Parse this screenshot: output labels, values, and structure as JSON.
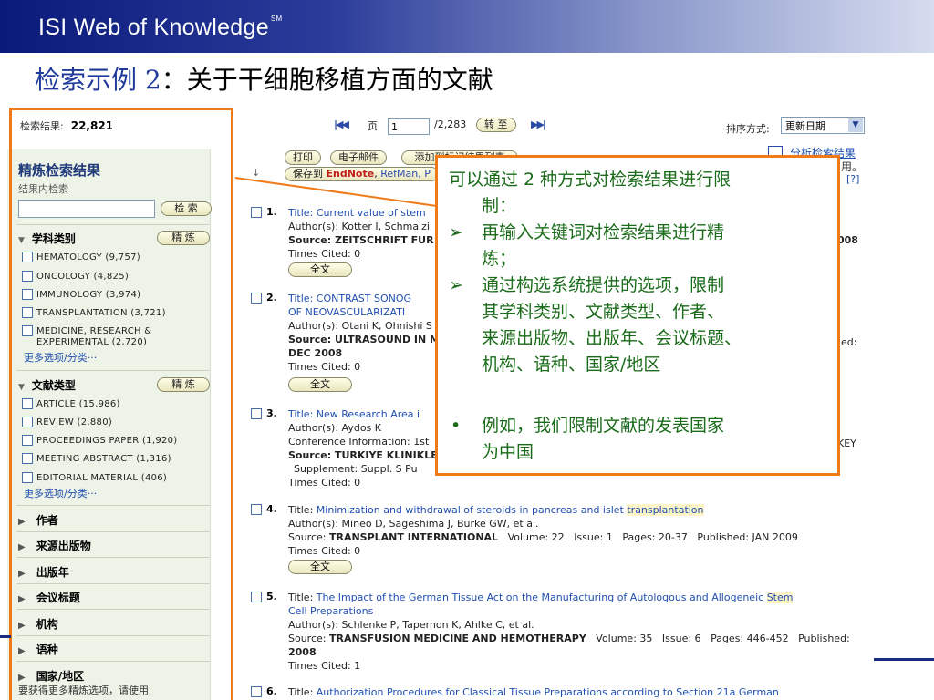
{
  "banner": {
    "title": "ISI Web of Knowledge",
    "trademark": "SM"
  },
  "slide_title": {
    "prefix": "检索示例 2",
    "rest": "：关于干细胞移植方面的文献"
  },
  "results": {
    "label": "检索结果:",
    "count": "22,821"
  },
  "pager": {
    "page_label": "页",
    "page_value": "1",
    "total": "/2,283",
    "go_label": "转 至"
  },
  "sort": {
    "label": "排序方式:",
    "value": "更新日期"
  },
  "toolbar": {
    "print": "打印",
    "email": "电子邮件",
    "add_marked": "添加到标记结果列表",
    "save_to": "保存到",
    "endnote": "EndNote",
    "refman": "RefMan, P"
  },
  "analyze": {
    "label": "分析检索结果",
    "suffix": "用。",
    "help": "[?]"
  },
  "sidebar": {
    "title": "精炼检索结果",
    "within": "结果内检索",
    "search_button": "检 索",
    "refine_button": "精 炼",
    "subject": {
      "heading": "学科类别",
      "items": [
        "HEMATOLOGY (9,757)",
        "ONCOLOGY (4,825)",
        "IMMUNOLOGY (3,974)",
        "TRANSPLANTATION (3,721)",
        "MEDICINE, RESEARCH &",
        "EXPERIMENTAL (2,720)"
      ],
      "more": "更多选项/分类···"
    },
    "doctype": {
      "heading": "文献类型",
      "items": [
        "ARTICLE (15,986)",
        "REVIEW (2,880)",
        "PROCEEDINGS PAPER (1,920)",
        "MEETING ABSTRACT (1,316)",
        "EDITORIAL MATERIAL (406)"
      ],
      "more": "更多选项/分类···"
    },
    "collapsed": [
      "作者",
      "来源出版物",
      "出版年",
      "会议标题",
      "机构",
      "语种",
      "国家/地区"
    ],
    "footnote": "要获得更多精炼选项，请使用"
  },
  "callout": {
    "line1": "可以通过 2 种方式对检索结果进行限",
    "line2": "制：",
    "b1a": "再输入关键词对检索结果进行精",
    "b1b": "炼；",
    "b2a": "通过构选系统提供的选项，限制",
    "b2b": "其学科类别、文献类型、作者、",
    "b2c": "来源出版物、出版年、会议标题、",
    "b2d": "机构、语种、国家/地区",
    "b3a": "例如，我们限制文献的发表国家",
    "b3b": "为中国",
    "arrow": "➢",
    "dot": "•"
  },
  "records": [
    {
      "num": "1.",
      "title": "Title: Current value of stem",
      "authors": "Author(s): Kotter I, Schmalzi",
      "source": "Source: ZEITSCHRIFT FUR R",
      "year_tail": "008",
      "cited": "Times Cited: 0",
      "fulltext": "全文"
    },
    {
      "num": "2.",
      "title1": "Title: CONTRAST SONOG",
      "title2": "OF NEOVASCULARIZATI",
      "authors": "Author(s): Otani K, Ohnishi S",
      "source": "Source: ULTRASOUND IN M",
      "tail": "ed:",
      "date": "DEC 2008",
      "cited": "Times Cited: 0",
      "fulltext": "全文"
    },
    {
      "num": "3.",
      "title": "Title: New Research Area i",
      "authors": "Author(s): Aydos K",
      "conf": "Conference Information: 1st",
      "source": "Source: TURKIYE KLINIKLEF",
      "tail": "KEY",
      "supp": "Supplement: Suppl. S   Pu",
      "cited": "Times Cited: 0"
    },
    {
      "num": "4.",
      "title_pre": "Title: ",
      "title_link": "Minimization and withdrawal of steroids in pancreas and islet ",
      "title_hl": "transplantation",
      "authors": "Author(s): Mineo D, Sageshima J, Burke GW, et al.",
      "source_pre": "Source: ",
      "source_j": "TRANSPLANT INTERNATIONAL",
      "vol": "Volume: 22",
      "issue": "Issue: 1",
      "pages": "Pages: 20-37",
      "pub": "Published: JAN 2009",
      "cited": "Times Cited: 0",
      "fulltext": "全文"
    },
    {
      "num": "5.",
      "title_pre": "Title: ",
      "title_link": "The Impact of the German Tissue Act on the Manufacturing of Autologous and Allogeneic ",
      "title_hl": "Stem",
      "title2": "Cell Preparations",
      "authors": "Author(s): Schlenke P, Tapernon K, Ahlke C, et al.",
      "source_pre": "Source: ",
      "source_j": "TRANSFUSION MEDICINE AND HEMOTHERAPY",
      "vol": "Volume: 35",
      "issue": "Issue: 6",
      "pages": "Pages: 446-452",
      "pub": "Published:",
      "year": "2008",
      "cited": "Times Cited: 1"
    },
    {
      "num": "6.",
      "title_pre": "Title: ",
      "title_link": "Authorization Procedures for Classical Tissue Preparations according to Section 21a German"
    }
  ]
}
